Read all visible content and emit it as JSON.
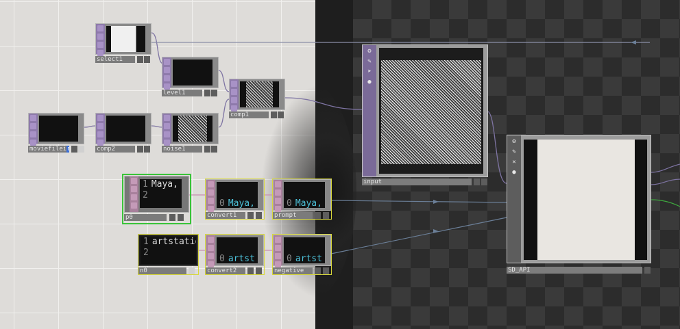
{
  "network": {
    "operators": {
      "select1": "select1",
      "level1": "level1",
      "comp1": "comp1",
      "moviefilein1": "moviefilei",
      "moviefilein1_flag": "n",
      "comp2": "comp2",
      "noise1": "noise1",
      "p0": "p0",
      "convert1": "convert1",
      "prompt": "prompt",
      "n0": "n0",
      "convert2": "convert2",
      "negative": "negative",
      "input": "input",
      "sd_api": "SD_API"
    },
    "text": {
      "p0_line1_num": "1",
      "p0_line1": "Maya,",
      "p0_line2_num": "2",
      "convert1_idx": "0",
      "convert1_val": "Maya,",
      "prompt_idx": "0",
      "prompt_val": "Maya,",
      "n0_line1_num": "1",
      "n0_line1": "artstatio",
      "n0_line2_num": "2",
      "convert2_idx": "0",
      "convert2_val": "artst",
      "negative_idx": "0",
      "negative_val": "artst"
    }
  },
  "icons": [
    "gear-icon",
    "pencil-icon",
    "clear-icon",
    "viewer-icon",
    "lock-icon"
  ],
  "colors": {
    "top_op": "#8e7aab",
    "dat_op": "#a8809c",
    "selected": "#39c439",
    "dat_highlight": "#d8d83a",
    "text_cyan": "#4cc0d8"
  }
}
